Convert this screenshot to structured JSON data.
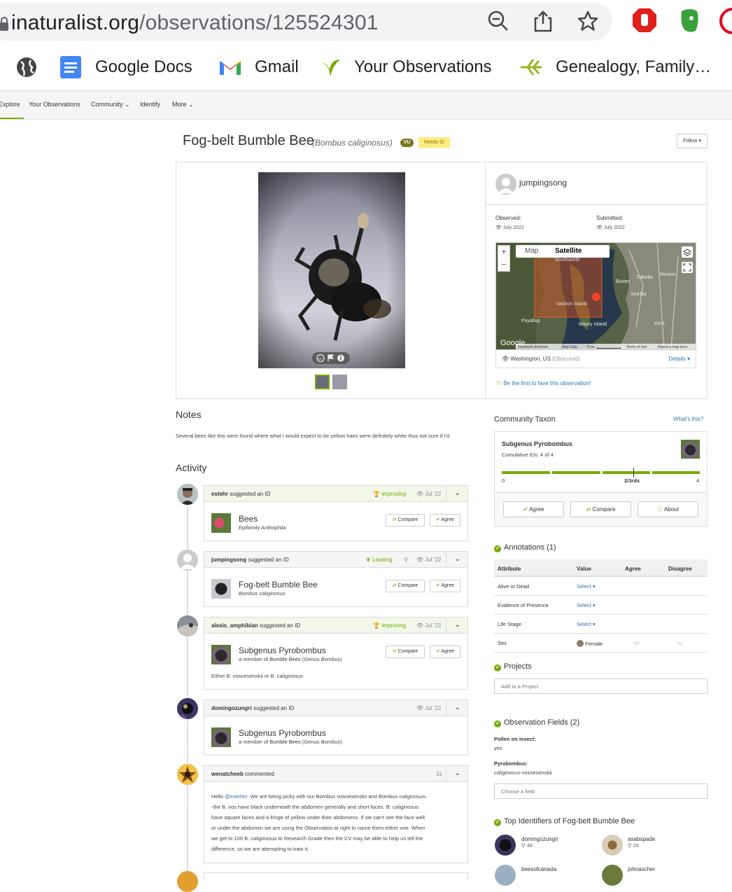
{
  "browser": {
    "url_host": "inaturalist.org",
    "url_path": "/observations/125524301",
    "bookmarks": [
      {
        "label": "Google Docs"
      },
      {
        "label": "Gmail"
      },
      {
        "label": "Your Observations"
      },
      {
        "label": "Genealogy, Family…"
      }
    ]
  },
  "nav": {
    "items": [
      "Explore",
      "Your Observations",
      "Community",
      "Identify",
      "More"
    ]
  },
  "observation": {
    "title": "Fog-belt Bumble Bee",
    "scientific_name": "(Bombus caliginosus)",
    "status_badge": "VU",
    "quality_badge": "Needs ID",
    "follow_label": "Follow",
    "user": "jumpingsong",
    "observed_label": "Observed:",
    "observed_date": "July 2022",
    "submitted_label": "Submitted:",
    "submitted_date": "July 2022",
    "map_tab_map": "Map",
    "map_tab_satellite": "Satellite",
    "map_labels": [
      "Southworth",
      "Vashon Island",
      "Maury Island",
      "Burien",
      "Tukwila",
      "SeaTac",
      "Renton",
      "Kent",
      "Puyallup"
    ],
    "map_attrib": [
      "Keyboard shortcuts",
      "Map Data",
      "5 km",
      "Terms of Use",
      "Report a map error"
    ],
    "google_logo": "Google",
    "location": "Washington, US",
    "location_note": "(Obscured)",
    "details_label": "Details",
    "fave_label": "Be the first to fave this observation!"
  },
  "notes": {
    "heading": "Notes",
    "text": "Several bees like this were found where what I would expect to be yellow hairs were definitely white thus not sure if I'd"
  },
  "activity": {
    "heading": "Activity",
    "items": [
      {
        "user": "estehr",
        "action": "suggested an ID",
        "status": "Improving",
        "date": "Jul '22",
        "taxon": "Bees",
        "taxon_sub": "Epifamily Anthophila",
        "compare": "Compare",
        "agree": "Agree"
      },
      {
        "user": "jumpingsong",
        "action": "suggested an ID",
        "status": "Leading",
        "date": "Jul '22",
        "taxon": "Fog-belt Bumble Bee",
        "taxon_sub": "Bombus caliginosus",
        "compare": "Compare",
        "agree": "Agree"
      },
      {
        "user": "alexis_amphibian",
        "action": "suggested an ID",
        "status": "Improving",
        "date": "Jul '22",
        "taxon": "Subgenus Pyrobombus",
        "taxon_sub_pre": "a member of",
        "taxon_sub_link": "Bumble Bees",
        "taxon_sub_post": "(Genus",
        "taxon_sub_genus": "Bombus",
        "taxon_sub_close": ")",
        "body": "Either B. vosnesenskii or B. caliginosus",
        "compare": "Compare",
        "agree": "Agree"
      },
      {
        "user": "domingozungri",
        "action": "suggested an ID",
        "date": "Jul '22",
        "taxon": "Subgenus Pyrobombus",
        "taxon_sub_pre": "a member of",
        "taxon_sub_link": "Bumble Bees",
        "taxon_sub_post": "(Genus",
        "taxon_sub_genus": "Bombus",
        "taxon_sub_close": ")"
      },
      {
        "user": "wenatcheeb",
        "action": "commented",
        "date": "1s",
        "body_prefix": "Hello",
        "mention": "@esteher",
        "body_lines": [
          ". We are being picky with our Bombus vosnesenskii and Bombus caliginosus-",
          "-the B. vos have black underneath the abdomen generally and short faces. B. caliginosus",
          "have square faces and a fringe of yellow under their abdomens. If we can't see the face well",
          "or under the abdomen we are using the Observation at right to name them either one. When",
          "we get to 100 B. caliginosus to Research Grade then the CV may be able to help us tell the",
          "difference, so we are attempting to train it."
        ]
      }
    ]
  },
  "community_taxon": {
    "heading": "Community Taxon",
    "whats_this": "What's this?",
    "taxon": "Subgenus Pyrobombus",
    "cumulative": "Cumulative IDs: 4 of 4",
    "scale_min": "0",
    "scale_mid": "2/3rds",
    "scale_max": "4",
    "agree": "Agree",
    "compare": "Compare",
    "about": "About"
  },
  "annotations": {
    "heading": "Annotations (1)",
    "columns": [
      "Attribute",
      "Value",
      "Agree",
      "Disagree"
    ],
    "rows": [
      {
        "attribute": "Alive or Dead",
        "value": "Select"
      },
      {
        "attribute": "Evidence of Presence",
        "value": "Select"
      },
      {
        "attribute": "Life Stage",
        "value": "Select"
      },
      {
        "attribute": "Sex",
        "value": "Female"
      }
    ]
  },
  "projects": {
    "heading": "Projects",
    "placeholder": "Add to a Project"
  },
  "obs_fields": {
    "heading": "Observation Fields (2)",
    "fields": [
      {
        "label": "Pollen on insect:",
        "value": "yes"
      },
      {
        "label": "Pyrobombus:",
        "value": "caliginosus-vosnesenskii"
      }
    ],
    "placeholder": "Choose a field"
  },
  "identifiers": {
    "heading": "Top Identifiers of Fog-belt Bumble Bee",
    "people": [
      {
        "name": "domingozungri",
        "count": "48"
      },
      {
        "name": "asabspade",
        "count": "26"
      },
      {
        "name": "beesofcanada",
        "count": ""
      },
      {
        "name": "johnascher",
        "count": ""
      }
    ]
  },
  "colors": {
    "accent": "#74ac00",
    "link": "#2e74b5",
    "needs_id": "#fceb7f",
    "vu": "#7b7620"
  }
}
